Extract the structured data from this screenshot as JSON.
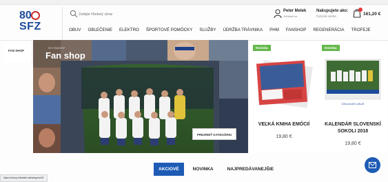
{
  "logo": {
    "number": "80",
    "text": "SFZ",
    "icon": "football-icon"
  },
  "search": {
    "placeholder": "Zadajte hľadaný výraz",
    "icon": "search-icon"
  },
  "user": {
    "name": "Peter Melek",
    "sub": "Odhlásiť sa",
    "icon": "user-icon"
  },
  "buying_as": {
    "label": "Nakupujete ako:",
    "value": "Fyzická osoba"
  },
  "cart": {
    "total": "161,20 €",
    "icon": "cart-icon"
  },
  "nav": [
    "OBUV",
    "OBLEČENIE",
    "ELEKTRO",
    "ŠPORTOVÉ POMÔCKY",
    "SLUŽBY",
    "ÚDRŽBA TRÁVNIKA",
    "PHM",
    "FANSHOP",
    "REGENERÁCIA",
    "TROFEJE"
  ],
  "sidebar": {
    "active_tab": "FAN SHOP"
  },
  "hero": {
    "tag": "SFZ FANSHOP",
    "title": "Fan shop",
    "button": "PREZRIEŤ KATEGÓRIU"
  },
  "products": [
    {
      "badge": "Novinka",
      "title": "VEĽKÁ KNIHA EMÓCIÍ",
      "price": "19,80 €"
    },
    {
      "badge": "Novinka",
      "title": "KALENDÁR SLOVENSKÍ SOKOLI 2018",
      "price": "19,80 €"
    }
  ],
  "tabs": [
    {
      "label": "AKCIOVÉ",
      "active": true
    },
    {
      "label": "NOVINKA",
      "active": false
    },
    {
      "label": "NAJPREDÁVANEJŠIE",
      "active": false
    }
  ],
  "chat": {
    "icon": "mail-icon"
  },
  "status_url": "https://eshop.futbalsfz.sk/kategoria/31",
  "colors": {
    "accent": "#1e5bb5",
    "badge": "#65b84b",
    "brand": "#1d4a9a"
  }
}
